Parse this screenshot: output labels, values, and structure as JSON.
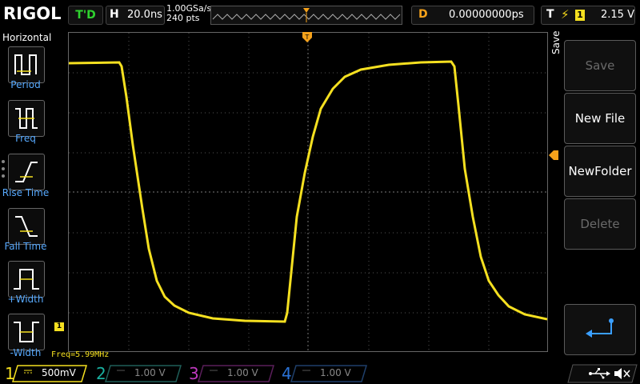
{
  "brand": "RIGOL",
  "status": "T'D",
  "horizontal": {
    "label": "H",
    "timebase": "20.0ns",
    "sample_rate": "1.00GSa/s",
    "points": "240  pts"
  },
  "delay": {
    "label": "D",
    "value": "0.00000000ps"
  },
  "trigger": {
    "label": "T",
    "source": "1",
    "level": "2.15 V",
    "edge_icon": "rising-edge-icon"
  },
  "left_menu": {
    "title": "Horizontal",
    "items": [
      {
        "label": "Period"
      },
      {
        "label": "Freq"
      },
      {
        "label": "Rise Time"
      },
      {
        "label": "Fall Time"
      },
      {
        "label": "+Width"
      },
      {
        "label": "-Width"
      }
    ]
  },
  "right_menu": {
    "title": "Save",
    "items": [
      {
        "label": "Save",
        "enabled": false
      },
      {
        "label": "New File",
        "enabled": true
      },
      {
        "label": "NewFolder",
        "enabled": true
      },
      {
        "label": "Delete",
        "enabled": false
      },
      {
        "label": "",
        "icon": "enter-icon"
      }
    ]
  },
  "measurement": "Freq=5.99MHz",
  "channel_marker": "1",
  "channels": [
    {
      "num": "1",
      "scale": "500mV",
      "active": true,
      "color": "#f5e020"
    },
    {
      "num": "2",
      "scale": "1.00 V",
      "active": false,
      "color": "#19b0a0"
    },
    {
      "num": "3",
      "scale": "1.00 V",
      "active": false,
      "color": "#c03ac0"
    },
    {
      "num": "4",
      "scale": "1.00 V",
      "active": false,
      "color": "#2a72d6"
    }
  ],
  "colors": {
    "ch1": "#f5e020",
    "trigger": "#f5a21b",
    "grid": "#6a6a6a",
    "menu_label": "#58aaff"
  }
}
